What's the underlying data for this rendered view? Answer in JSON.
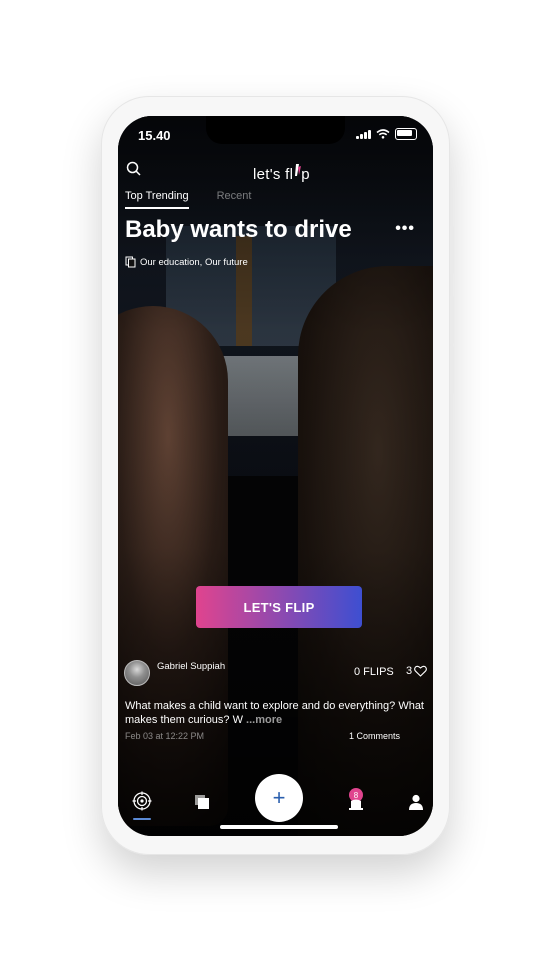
{
  "status_bar": {
    "time": "15.40"
  },
  "header": {
    "logo_text": "let's fl",
    "logo_tail": "p",
    "tabs": [
      {
        "label": "Top Trending",
        "active": true
      },
      {
        "label": "Recent",
        "active": false
      }
    ]
  },
  "post": {
    "title": "Baby wants to drive",
    "more_label": "•••",
    "category": "Our education, Our future",
    "cta_label": "LET'S FLIP",
    "cta_gradient": [
      "#e0448e",
      "#3e4fd1"
    ],
    "author": "Gabriel Suppiah",
    "flips": "0 FLIPS",
    "likes": "3",
    "description": "What makes a child want to explore and do everything? What makes them curious? W ",
    "description_more": "...more",
    "date": "Feb 03 at 12:22 PM",
    "comments": "1 Comments"
  },
  "bottom_nav": {
    "items": [
      "explore-icon",
      "collections-icon",
      "add-icon",
      "notifications-icon",
      "profile-icon"
    ],
    "add_label": "+",
    "notification_badge": "8",
    "accent": "#5b8ad6"
  }
}
